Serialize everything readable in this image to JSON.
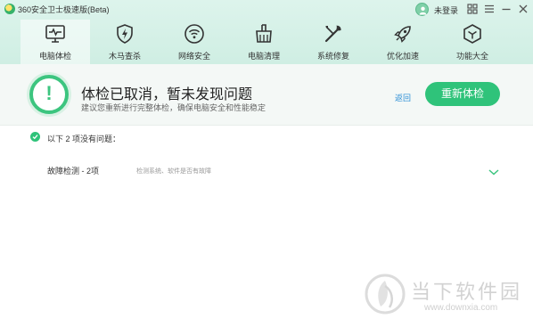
{
  "window": {
    "title": "360安全卫士极速版(Beta)",
    "login_text": "未登录",
    "buttons": [
      "skin-icon",
      "menu-icon",
      "minimize-icon",
      "close-icon"
    ]
  },
  "nav": {
    "items": [
      {
        "label": "电脑体检",
        "icon": "monitor-icon",
        "active": true
      },
      {
        "label": "木马查杀",
        "icon": "shield-bolt-icon",
        "active": false
      },
      {
        "label": "网络安全",
        "icon": "wifi-icon",
        "active": false
      },
      {
        "label": "电脑清理",
        "icon": "broom-icon",
        "active": false
      },
      {
        "label": "系统修复",
        "icon": "wrench-icon",
        "active": false
      },
      {
        "label": "优化加速",
        "icon": "rocket-icon",
        "active": false
      },
      {
        "label": "功能大全",
        "icon": "cube-icon",
        "active": false
      }
    ]
  },
  "status": {
    "mark": "!",
    "title": "体检已取消，暂未发现问题",
    "subtitle": "建议您重新进行完整体检，确保电脑安全和性能稳定",
    "return_label": "返回",
    "recheck_label": "重新体检"
  },
  "results": {
    "summary": "以下 2 项没有问题：",
    "items": [
      {
        "name": "故障检测 - 2项",
        "description": "检测系统、软件是否有故障"
      }
    ]
  },
  "watermark": {
    "cn": "当下软件园",
    "url": "www.downxia.com"
  },
  "colors": {
    "accent": "#2fc37a",
    "header_bg": "#d6f1e8",
    "link": "#2d8fd6"
  }
}
